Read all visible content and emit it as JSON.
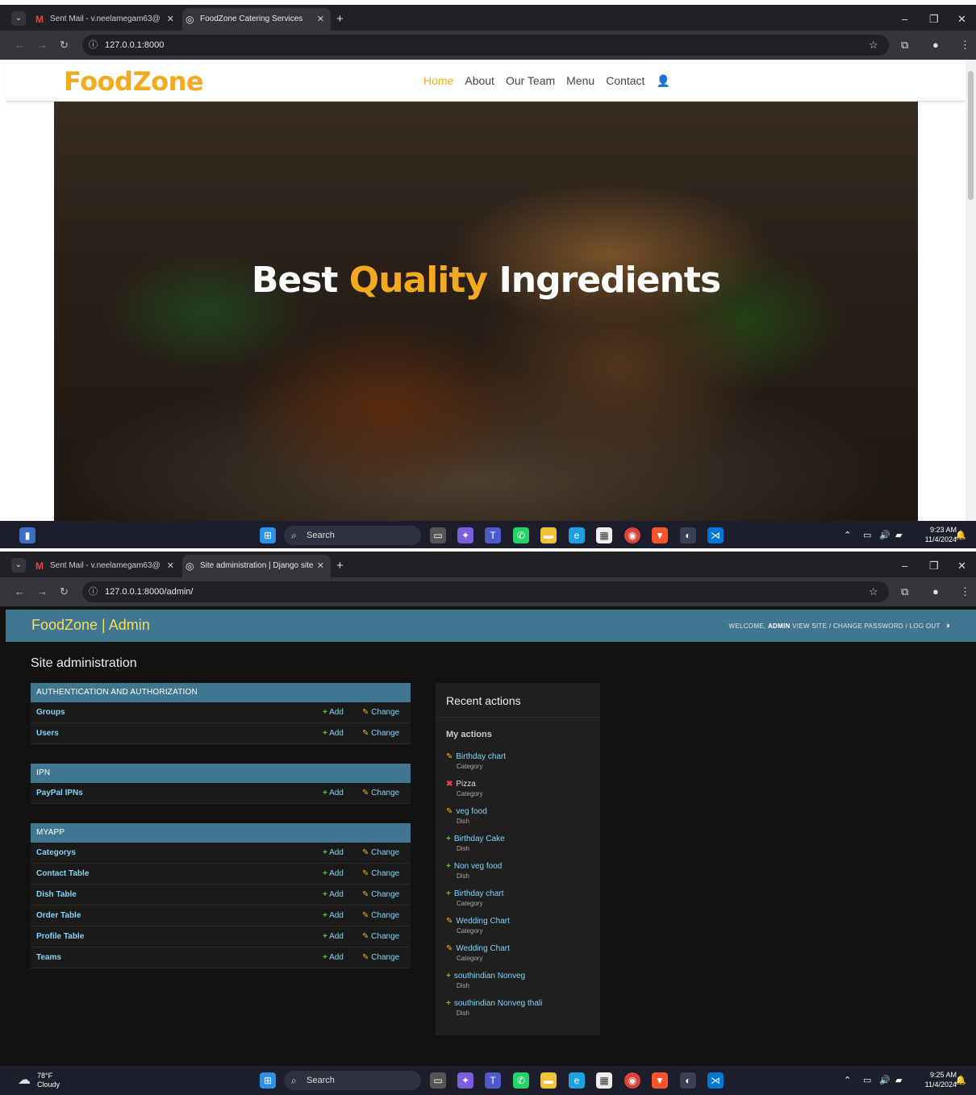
{
  "shot1": {
    "tabs": [
      {
        "label": "Sent Mail - v.neelamegam63@",
        "active": false
      },
      {
        "label": "FoodZone Catering Services",
        "active": true
      }
    ],
    "url": "127.0.0.1:8000",
    "site": {
      "logo": "FoodZone",
      "nav": [
        {
          "label": "Home",
          "active": true
        },
        {
          "label": "About",
          "active": false
        },
        {
          "label": "Our Team",
          "active": false
        },
        {
          "label": "Menu",
          "active": false
        },
        {
          "label": "Contact",
          "active": false
        }
      ],
      "hero_title_part1": "Best",
      "hero_title_highlight": "Quality",
      "hero_title_part2": "Ingredients"
    },
    "taskbar": {
      "search": "Search",
      "time": "9:23 AM",
      "date": "11/4/2024"
    }
  },
  "shot2": {
    "tabs": [
      {
        "label": "Sent Mail - v.neelamegam63@",
        "active": false
      },
      {
        "label": "Site administration | Django site",
        "active": true
      }
    ],
    "url": "127.0.0.1:8000/admin/",
    "admin": {
      "brand": "FoodZone | Admin",
      "welcome": "WELCOME,",
      "user": "ADMIN",
      "tools": "VIEW SITE / CHANGE PASSWORD / LOG OUT",
      "title": "Site administration",
      "add_label": "Add",
      "change_label": "Change",
      "modules": [
        {
          "caption": "AUTHENTICATION AND AUTHORIZATION",
          "models": [
            "Groups",
            "Users"
          ]
        },
        {
          "caption": "IPN",
          "models": [
            "PayPal IPNs"
          ]
        },
        {
          "caption": "MYAPP",
          "models": [
            "Categorys",
            "Contact Table",
            "Dish Table",
            "Order Table",
            "Profile Table",
            "Teams"
          ]
        }
      ],
      "recent_title": "Recent actions",
      "my_actions_title": "My actions",
      "actions": [
        {
          "name": "Birthday chart",
          "type": "Category",
          "kind": "change"
        },
        {
          "name": "Pizza",
          "type": "Category",
          "kind": "delete"
        },
        {
          "name": "veg food",
          "type": "Dish",
          "kind": "change"
        },
        {
          "name": "Birthday Cake",
          "type": "Dish",
          "kind": "add"
        },
        {
          "name": "Non veg food",
          "type": "Dish",
          "kind": "add"
        },
        {
          "name": "Birthday chart",
          "type": "Category",
          "kind": "add"
        },
        {
          "name": "Wedding Chart",
          "type": "Category",
          "kind": "change"
        },
        {
          "name": "Wedding Chart",
          "type": "Category",
          "kind": "change"
        },
        {
          "name": "southindian Nonveg",
          "type": "Dish",
          "kind": "add"
        },
        {
          "name": "southindian Nonveg thali",
          "type": "Dish",
          "kind": "add"
        }
      ]
    },
    "taskbar": {
      "weather_temp": "78°F",
      "weather_desc": "Cloudy",
      "search": "Search",
      "time": "9:25 AM",
      "date": "11/4/2024"
    }
  },
  "colors": {
    "brand": "#f3a920",
    "admin_header": "#417690",
    "admin_brand": "#f5dd5d",
    "link": "#81d4fa",
    "add": "#70bf2b",
    "change": "#efb80b",
    "delete": "#dd4646"
  },
  "icons": {
    "user": "user-icon",
    "add": "plus-icon",
    "change": "pencil-icon",
    "delete": "x-icon",
    "theme": "contrast-icon"
  }
}
